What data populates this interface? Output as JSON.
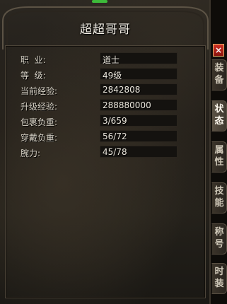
{
  "window": {
    "title": "超超哥哥",
    "close_label": "×"
  },
  "stats": [
    {
      "label": "职  业:",
      "value": "道士"
    },
    {
      "label": "等  级:",
      "value": "49级"
    },
    {
      "label": "当前经验:",
      "value": "2842808"
    },
    {
      "label": "升级经验:",
      "value": "288880000"
    },
    {
      "label": "包裹负重:",
      "value": "3/659"
    },
    {
      "label": "穿戴负重:",
      "value": "56/72"
    },
    {
      "label": "腕力:",
      "value": "45/78"
    }
  ],
  "tabs": [
    {
      "c1": "装",
      "c2": "备"
    },
    {
      "c1": "状",
      "c2": "态"
    },
    {
      "c1": "属",
      "c2": "性"
    },
    {
      "c1": "技",
      "c2": "能"
    },
    {
      "c1": "称",
      "c2": "号"
    },
    {
      "c1": "时",
      "c2": "装"
    }
  ],
  "active_tab": "状态"
}
